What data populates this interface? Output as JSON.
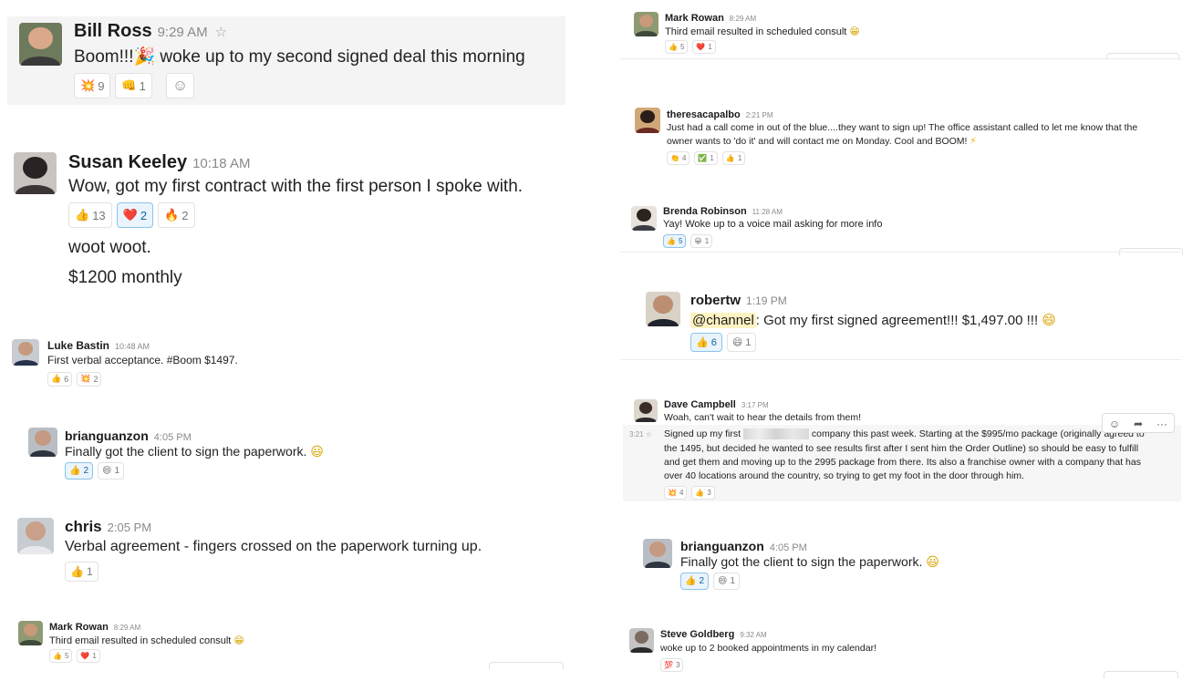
{
  "left": {
    "bill": {
      "name": "Bill Ross",
      "time": "9:29 AM",
      "text_before": "Boom!!!",
      "party": "🎉",
      "text_after": " woke up to my second signed deal this morning",
      "r1_emoji": "💥",
      "r1_count": "9",
      "r2_emoji": "👊",
      "r2_count": "1",
      "add_reaction": "☺"
    },
    "susan": {
      "name": "Susan Keeley",
      "time": "10:18 AM",
      "line1": "Wow, got my first contract with the first person I spoke with.",
      "line2": "woot woot.",
      "line3": "$1200 monthly",
      "r1_emoji": "👍",
      "r1_count": "13",
      "r2_emoji": "❤️",
      "r2_count": "2",
      "r3_emoji": "🔥",
      "r3_count": "2"
    },
    "luke": {
      "name": "Luke Bastin",
      "time": "10:48 AM",
      "text": "First verbal acceptance. #Boom $1497.",
      "r1_emoji": "👍",
      "r1_count": "6",
      "r2_emoji": "💥",
      "r2_count": "2"
    },
    "brian": {
      "name": "brianguanzon",
      "time": "4:05 PM",
      "text": "Finally got the client to sign the paperwork.",
      "smile": "😃",
      "r1_emoji": "👍",
      "r1_count": "2",
      "r2_emoji": "😄",
      "r2_count": "1"
    },
    "chris": {
      "name": "chris",
      "time": "2:05 PM",
      "text": "Verbal agreement - fingers crossed on the paperwork turning up.",
      "r1_emoji": "👍",
      "r1_count": "1"
    },
    "mark": {
      "name": "Mark Rowan",
      "time": "8:29 AM",
      "text": "Third email resulted in scheduled consult",
      "grin": "😁",
      "r1_emoji": "👍",
      "r1_count": "5",
      "r2_emoji": "❤️",
      "r2_count": "1"
    }
  },
  "right": {
    "mark": {
      "name": "Mark Rowan",
      "time": "8:29 AM",
      "text": "Third email resulted in scheduled consult",
      "grin": "😁",
      "r1_emoji": "👍",
      "r1_count": "5",
      "r2_emoji": "❤️",
      "r2_count": "1"
    },
    "theresa": {
      "name": "theresacapalbo",
      "time": "2:21 PM",
      "line1": "Just had a call come in out of the blue....they want to sign up!  The office assistant called to let me know that the",
      "line2": "owner wants to 'do it' and will contact me on Monday.  Cool and BOOM!",
      "bolt": "⚡",
      "r1_emoji": "👏",
      "r1_count": "4",
      "r2_emoji": "✅",
      "r2_count": "1",
      "r3_emoji": "👍",
      "r3_count": "1"
    },
    "brenda": {
      "name": "Brenda Robinson",
      "time": "11:28 AM",
      "text": "Yay! Woke up to a voice mail asking for more info",
      "r1_emoji": "👍",
      "r1_count": "5",
      "r2_emoji": "😀",
      "r2_count": "1"
    },
    "robert": {
      "name": "robertw",
      "time": "1:19 PM",
      "mention": "@channel",
      "text": ": Got my first signed agreement!!!  $1,497.00 !!!",
      "smile": "😄",
      "r1_emoji": "👍",
      "r1_count": "6",
      "r2_emoji": "😄",
      "r2_count": "1"
    },
    "dave": {
      "name": "Dave Campbell",
      "time": "3:17 PM",
      "text": "Woah, can't wait to hear the details from them!",
      "side_time": "3:21",
      "side_star": "☆",
      "l1a": "Signed up my first",
      "l1b": "company this past week. Starting at the $995/mo package (originally agreed to",
      "l2": "the 1495, but decided he wanted to see results first after I sent him the Order Outline) so should be easy to fulfill",
      "l3": "and get them and moving up to the 2995 package from there. Its also a franchise owner with a company that has",
      "l4": "over 40 locations around the country, so trying to get my foot in the door through him.",
      "r1_emoji": "💥",
      "r1_count": "4",
      "r2_emoji": "👍",
      "r2_count": "3",
      "tb_react": "☺",
      "tb_share": "➦",
      "tb_more": "···"
    },
    "brian": {
      "name": "brianguanzon",
      "time": "4:05 PM",
      "text": "Finally got the client to sign the paperwork.",
      "smile": "😃",
      "r1_emoji": "👍",
      "r1_count": "2",
      "r2_emoji": "😄",
      "r2_count": "1"
    },
    "steve": {
      "name": "Steve Goldberg",
      "time": "9:32 AM",
      "text": "woke up to 2 booked appointments in my calendar!",
      "r1_emoji": "💯",
      "r1_count": "3"
    }
  }
}
